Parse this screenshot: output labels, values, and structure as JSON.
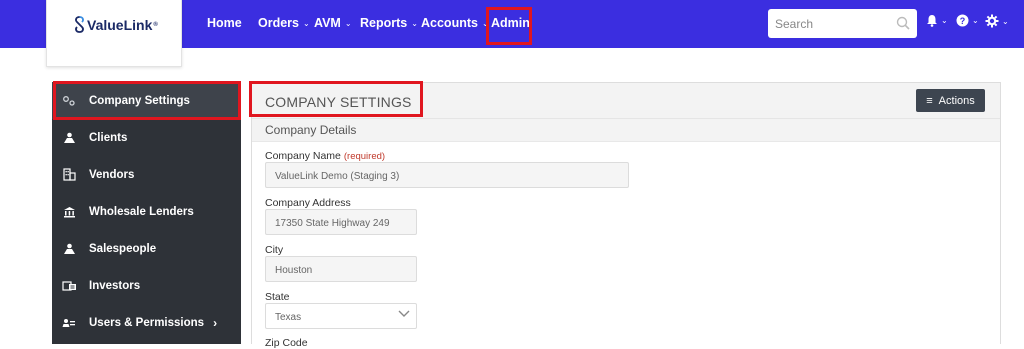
{
  "brand": {
    "name": "ValueLink",
    "mark": "®"
  },
  "nav": {
    "home": "Home",
    "orders": "Orders",
    "avm": "AVM",
    "reports": "Reports",
    "accounts": "Accounts",
    "admin": "Admin"
  },
  "search": {
    "placeholder": "Search"
  },
  "topicons": [
    "bell-icon",
    "help-icon",
    "gear-icon"
  ],
  "sidebar": {
    "items": [
      {
        "label": "Company Settings",
        "icon": "gears-icon"
      },
      {
        "label": "Clients",
        "icon": "sitemap-icon"
      },
      {
        "label": "Vendors",
        "icon": "building-icon"
      },
      {
        "label": "Wholesale Lenders",
        "icon": "bank-icon"
      },
      {
        "label": "Salespeople",
        "icon": "sitemap-icon"
      },
      {
        "label": "Investors",
        "icon": "money-icon"
      },
      {
        "label": "Users & Permissions",
        "icon": "users-icon"
      }
    ]
  },
  "panel": {
    "title": "COMPANY SETTINGS",
    "actions_label": "Actions",
    "section": "Company Details",
    "fields": {
      "company_name_label": "Company Name",
      "company_name_required": "(required)",
      "company_name_value": "ValueLink Demo (Staging 3)",
      "address_label": "Company Address",
      "address_value": "17350 State Highway 249",
      "city_label": "City",
      "city_value": "Houston",
      "state_label": "State",
      "state_value": "Texas",
      "zip_label": "Zip Code"
    }
  },
  "colors": {
    "topbar": "#3b2ee0",
    "sidebar": "#2e3238",
    "highlight": "#e0161f"
  }
}
